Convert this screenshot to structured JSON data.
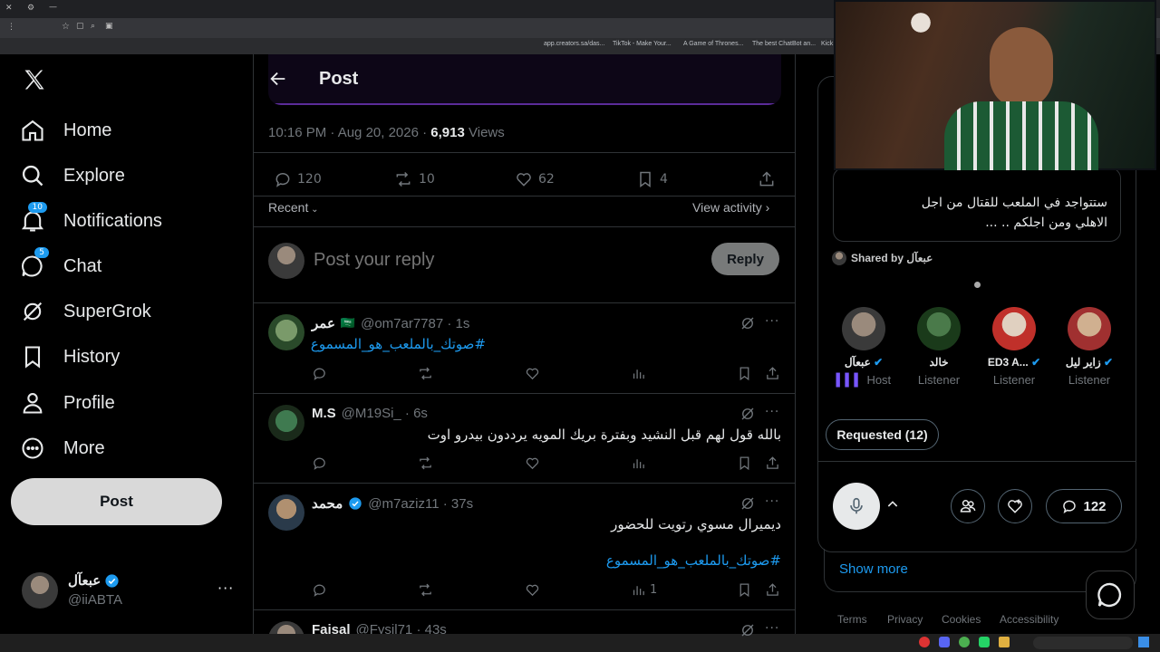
{
  "browser": {
    "bookmarks": [
      "app.creators.sa/das...",
      "TikTok - Make Your...",
      "A Game of Thrones...",
      "The best ChatBot an...",
      "Kick"
    ]
  },
  "nav": {
    "items": [
      {
        "label": "Home",
        "icon": "home-icon"
      },
      {
        "label": "Explore",
        "icon": "search-icon"
      },
      {
        "label": "Notifications",
        "icon": "bell-icon",
        "badge": "10"
      },
      {
        "label": "Chat",
        "icon": "chat-icon",
        "badge": "5"
      },
      {
        "label": "SuperGrok",
        "icon": "grok-icon"
      },
      {
        "label": "History",
        "icon": "bookmark-icon"
      },
      {
        "label": "Profile",
        "icon": "person-icon"
      },
      {
        "label": "More",
        "icon": "more-circle-icon"
      }
    ],
    "post_label": "Post",
    "account": {
      "name": "عبعآل",
      "handle": "@iiABTA"
    }
  },
  "post": {
    "header_title": "Post",
    "meta_time": "10:16 PM · Aug 20, 2026 ·",
    "views_count": "6,913",
    "views_label": "Views",
    "stats": {
      "replies": "120",
      "reposts": "10",
      "likes": "62",
      "bookmarks": "4"
    },
    "sort_label": "Recent",
    "view_activity": "View activity",
    "reply_placeholder": "Post your reply",
    "reply_button": "Reply"
  },
  "replies": [
    {
      "name": "عمر",
      "flag": "🇸🇦",
      "handle": "@om7ar7787 · 1s",
      "lines": [
        "#صوتك_بالملعب_هو_المسموع"
      ],
      "hashtag_lines": [
        0
      ],
      "views": ""
    },
    {
      "name": "M.S",
      "handle": "@M19Si_ · 6s",
      "lines": [
        "بالله قول لهم قبل النشيد وبفترة بريك المويه يرددون  بيدرو اوت"
      ],
      "hashtag_lines": [],
      "views": ""
    },
    {
      "name": "محمد",
      "handle": "@m7aziz11 · 37s",
      "lines": [
        "ديميرال مسوي رتويت للحضور",
        "#صوتك_بالملعب_هو_المسموع"
      ],
      "hashtag_lines": [
        1
      ],
      "views": "1"
    },
    {
      "name": "Faisal",
      "handle": "@Fysil71 · 43s",
      "lines": [],
      "hashtag_lines": [],
      "views": ""
    }
  ],
  "space": {
    "pinned_text_1": "ستتواجد في الملعب للقتال من اجل",
    "pinned_text_2": "الاهلي ومن اجلكم .. ...",
    "shared_by": "Shared by عبعآل",
    "speakers": [
      {
        "name": "عبعآل",
        "role": "Host",
        "verified": true
      },
      {
        "name": "خالد",
        "role": "Listener",
        "verified": false
      },
      {
        "name": "ED3 A...",
        "role": "Listener",
        "verified": true
      },
      {
        "name": "زاير ليل",
        "role": "Listener",
        "verified": true
      }
    ],
    "requested": "Requested (12)",
    "comments_count": "122",
    "show_more": "Show more"
  },
  "footer": {
    "links": [
      "Terms",
      "Privacy",
      "Cookies",
      "Accessibility"
    ]
  },
  "colors": {
    "accent": "#1d9bf0",
    "purple": "#5b2b99",
    "host": "#7856ff"
  }
}
